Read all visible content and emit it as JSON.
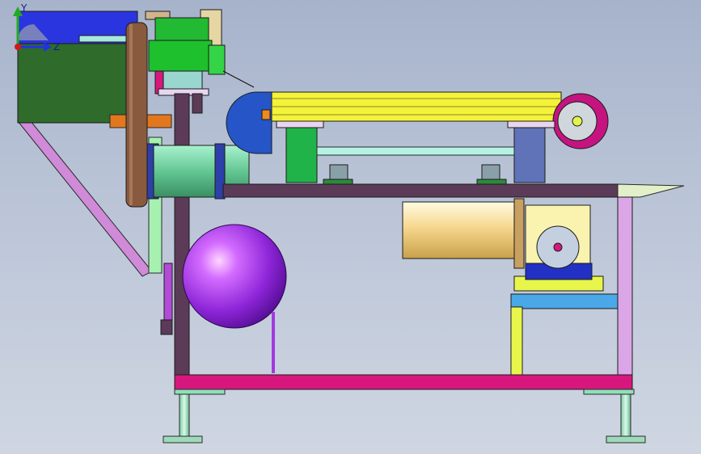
{
  "viewport": {
    "background_top": "#a6b3cb",
    "background_bottom": "#cfd6e2",
    "model_colors": {
      "frame_magenta": "#d8177e",
      "frame_purple": "#5b3b58",
      "rail_yellow": "#f4f23b",
      "motor_blue": "#2555c7",
      "housing_green": "#1ec02e",
      "cylinder_mint": "#8fe0b9",
      "sphere_violet": "#b642f2",
      "drum_tan": "#f6d78e",
      "leg_olive": "#2c6a2a",
      "bracket_lilac": "#dba6e6"
    }
  },
  "triad": {
    "y_label": "Y",
    "z_label": "Z",
    "y_color": "#22aa22",
    "z_color": "#2233dd",
    "origin_color": "#d01a1a"
  }
}
